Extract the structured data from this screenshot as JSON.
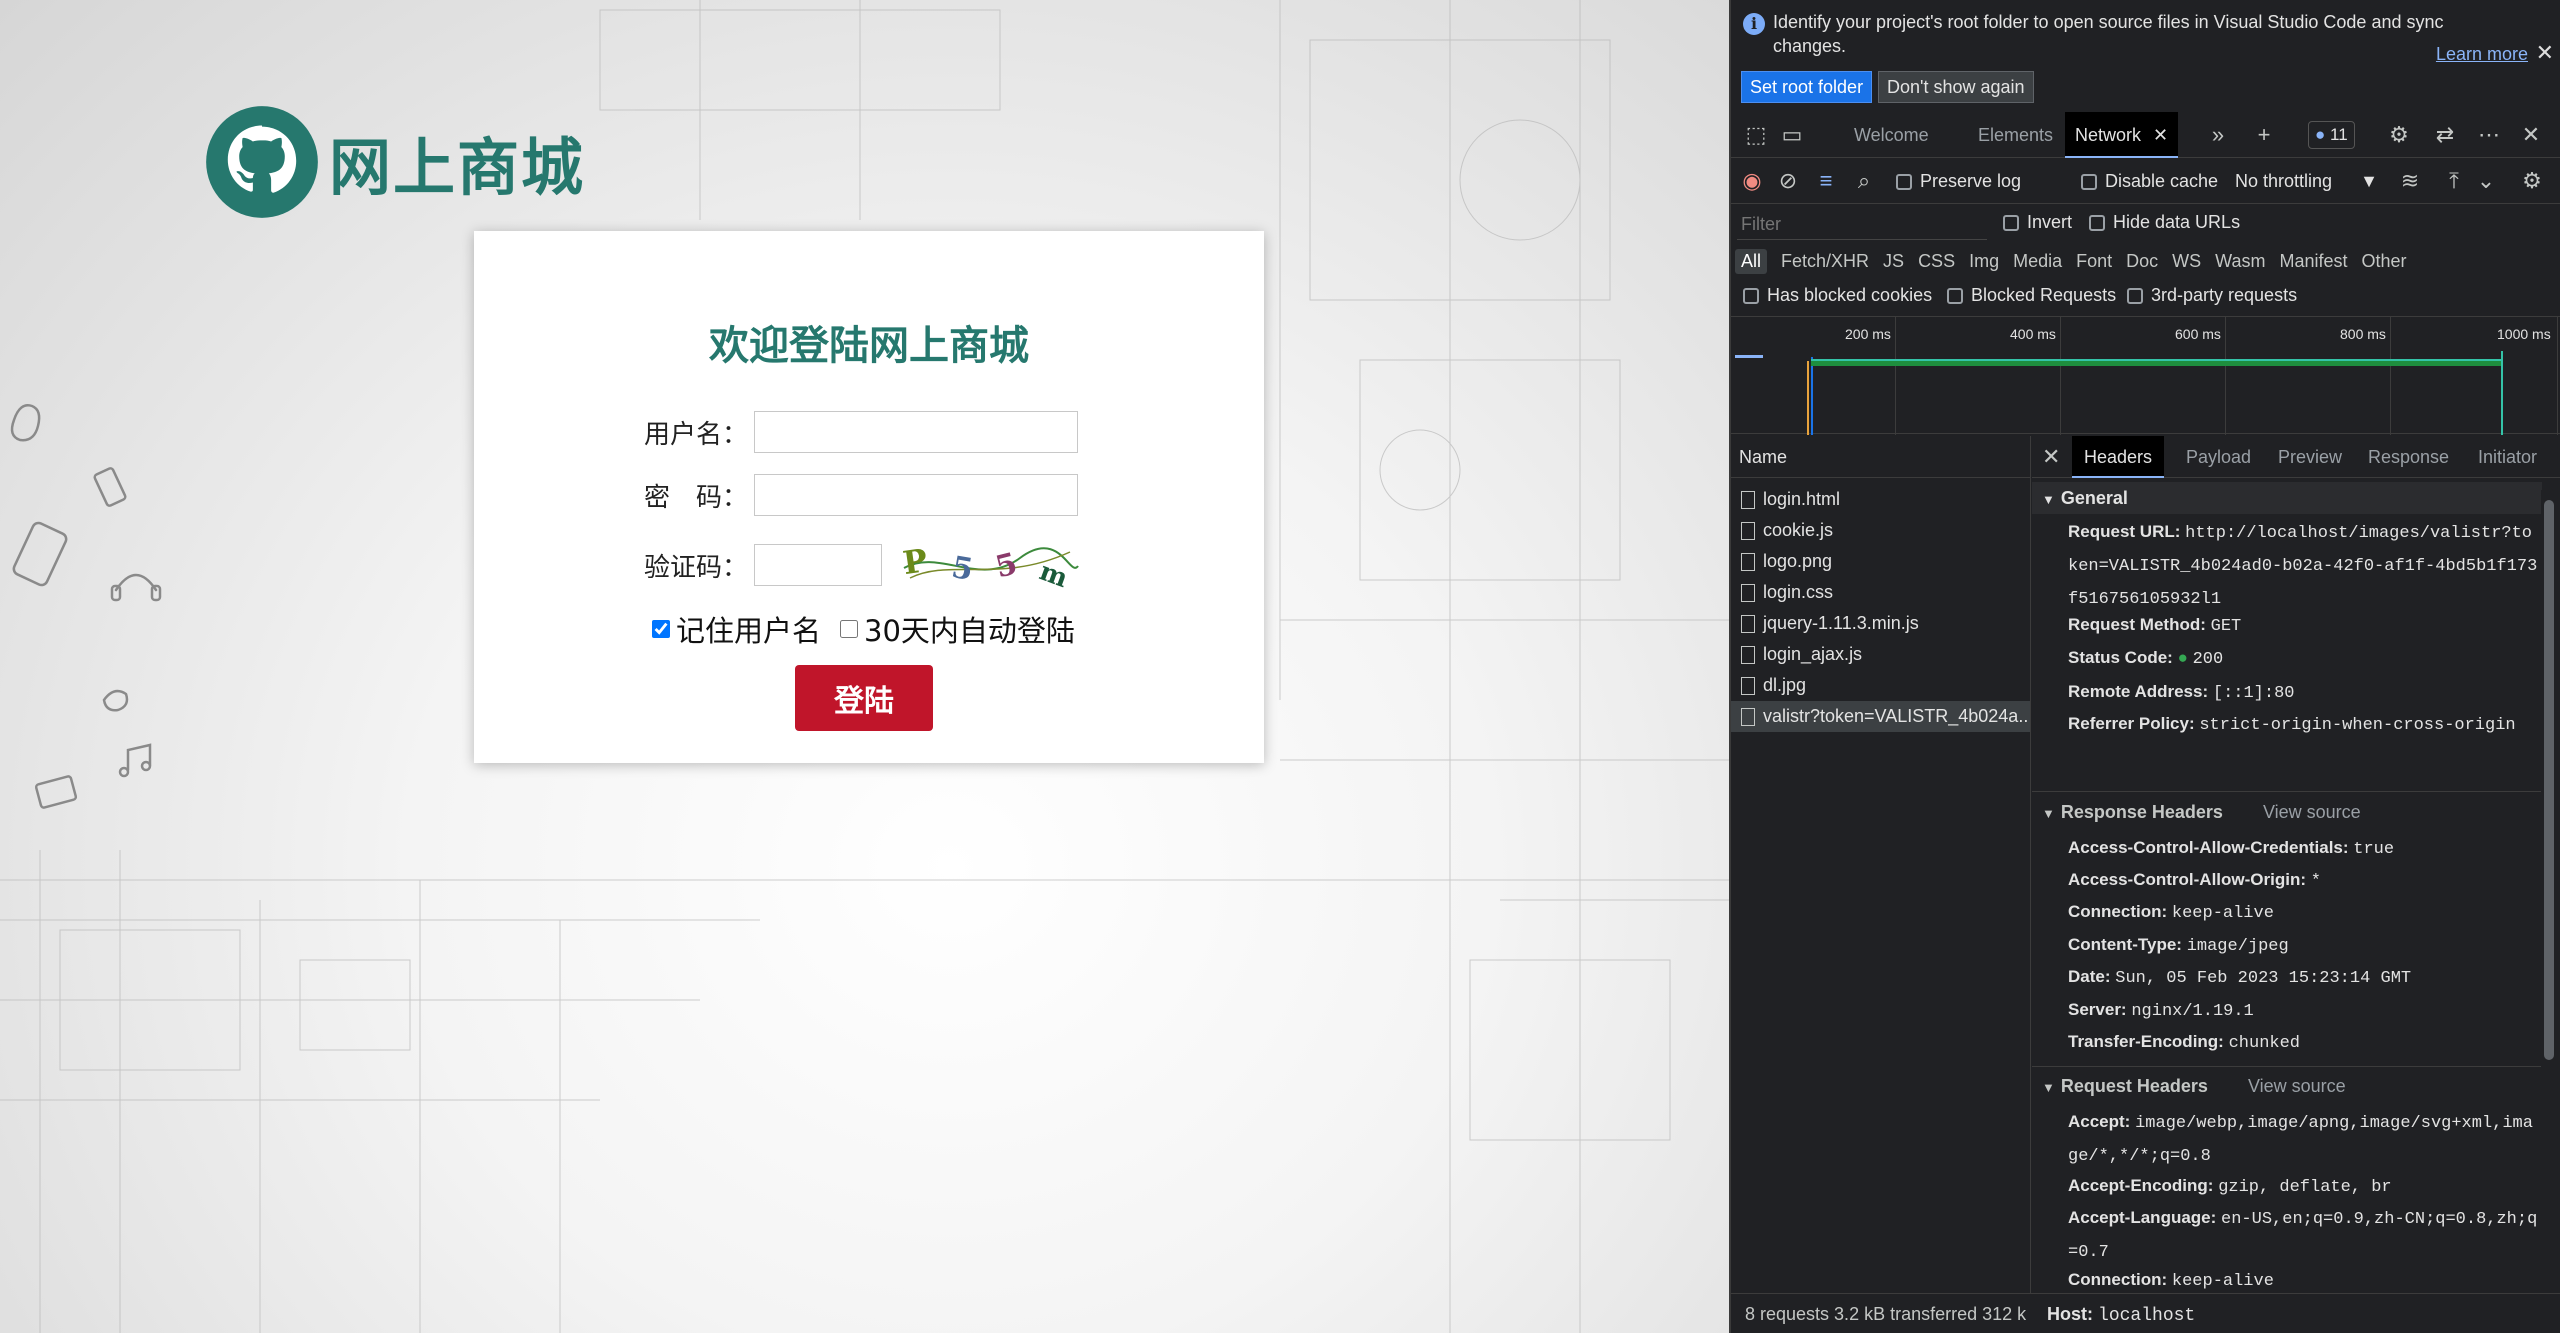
{
  "login_page": {
    "logo_text": "网上商城",
    "card_title": "欢迎登陆网上商城",
    "username_label": "用户名：",
    "password_label": "密　码：",
    "captcha_label": "验证码：",
    "captcha_text": "P 5 5 m",
    "remember_label": "记住用户名",
    "auto_login_label": "30天内自动登陆",
    "remember_checked": true,
    "auto_login_checked": false,
    "login_button": "登陆"
  },
  "devtools": {
    "infobar": {
      "message": "Identify your project's root folder to open source files in Visual Studio Code and sync changes.",
      "learn_more": "Learn more",
      "set_root": "Set root folder",
      "dont_show": "Don't show again"
    },
    "tabs": {
      "welcome": "Welcome",
      "elements": "Elements",
      "network": "Network",
      "issues_count": "11"
    },
    "toolbar": {
      "preserve_log": "Preserve log",
      "disable_cache": "Disable cache",
      "throttling": "No throttling"
    },
    "filter": {
      "placeholder": "Filter",
      "invert": "Invert",
      "hide_data_urls": "Hide data URLs"
    },
    "types": [
      "All",
      "Fetch/XHR",
      "JS",
      "CSS",
      "Img",
      "Media",
      "Font",
      "Doc",
      "WS",
      "Wasm",
      "Manifest",
      "Other"
    ],
    "cookies": {
      "blocked_cookies": "Has blocked cookies",
      "blocked_requests": "Blocked Requests",
      "third_party": "3rd-party requests"
    },
    "timeline_ticks": [
      "200 ms",
      "400 ms",
      "600 ms",
      "800 ms",
      "1000 ms"
    ],
    "name_header": "Name",
    "requests": [
      "login.html",
      "cookie.js",
      "logo.png",
      "login.css",
      "jquery-1.11.3.min.js",
      "login_ajax.js",
      "dl.jpg",
      "valistr?token=VALISTR_4b024a..."
    ],
    "detail_tabs": [
      "Headers",
      "Payload",
      "Preview",
      "Response",
      "Initiator"
    ],
    "general": {
      "title": "General",
      "request_url_k": "Request URL:",
      "request_url_v": "http://localhost/images/valistr?token=VALISTR_4b024ad0-b02a-42f0-af1f-4bd5b1f173f516756105932l1",
      "method_k": "Request Method:",
      "method_v": "GET",
      "status_k": "Status Code:",
      "status_v": "200",
      "remote_k": "Remote Address:",
      "remote_v": "[::1]:80",
      "referrer_k": "Referrer Policy:",
      "referrer_v": "strict-origin-when-cross-origin"
    },
    "response_headers": {
      "title": "Response Headers",
      "view_source": "View source",
      "rows": [
        {
          "k": "Access-Control-Allow-Credentials:",
          "v": "true"
        },
        {
          "k": "Access-Control-Allow-Origin:",
          "v": "*"
        },
        {
          "k": "Connection:",
          "v": "keep-alive"
        },
        {
          "k": "Content-Type:",
          "v": "image/jpeg"
        },
        {
          "k": "Date:",
          "v": "Sun, 05 Feb 2023 15:23:14 GMT"
        },
        {
          "k": "Server:",
          "v": "nginx/1.19.1"
        },
        {
          "k": "Transfer-Encoding:",
          "v": "chunked"
        }
      ]
    },
    "request_headers": {
      "title": "Request Headers",
      "view_source": "View source",
      "accept_k": "Accept:",
      "accept_v": "image/webp,image/apng,image/svg+xml,image/*,*/*;q=0.8",
      "enc_k": "Accept-Encoding:",
      "enc_v": "gzip, deflate, br",
      "lang_k": "Accept-Language:",
      "lang_v": "en-US,en;q=0.9,zh-CN;q=0.8,zh;q=0.7",
      "conn_k": "Connection:",
      "conn_v": "keep-alive",
      "host_k": "Host:",
      "host_v": "localhost"
    },
    "status_bar": "8 requests  3.2 kB transferred  312 k"
  }
}
